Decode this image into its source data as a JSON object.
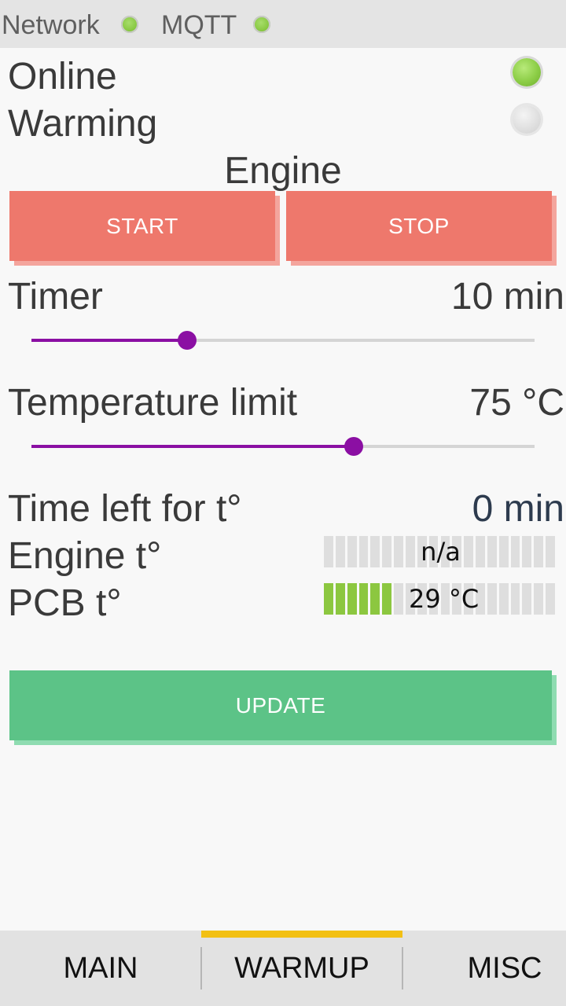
{
  "statusbar": {
    "network_label": "Network",
    "mqtt_label": "MQTT"
  },
  "status": {
    "online_label": "Online",
    "online_state": "on",
    "warming_label": "Warming",
    "warming_state": "off"
  },
  "engine": {
    "title": "Engine",
    "start_label": "START",
    "stop_label": "STOP"
  },
  "timer": {
    "label": "Timer",
    "value": "10 min",
    "slider_fraction": 0.31
  },
  "temperature_limit": {
    "label": "Temperature limit",
    "value": "75 °C",
    "slider_fraction": 0.64
  },
  "time_left": {
    "label": "Time left for t°",
    "value": "0 min"
  },
  "engine_temp": {
    "label": "Engine t°",
    "value": "n/a",
    "level_segments": 0,
    "total_segments": 20
  },
  "pcb_temp": {
    "label": "PCB t°",
    "value": "29 °C",
    "level_segments": 6,
    "total_segments": 20
  },
  "update_label": "UPDATE",
  "tabs": [
    {
      "label": "MAIN",
      "active": false
    },
    {
      "label": "WARMUP",
      "active": true
    },
    {
      "label": "MISC",
      "active": false
    }
  ],
  "colors": {
    "accent": "#8b0fa3",
    "button_red": "#ee786c",
    "button_green": "#5cc387",
    "tab_indicator": "#f2c014",
    "led_green": "#8ccd46"
  }
}
